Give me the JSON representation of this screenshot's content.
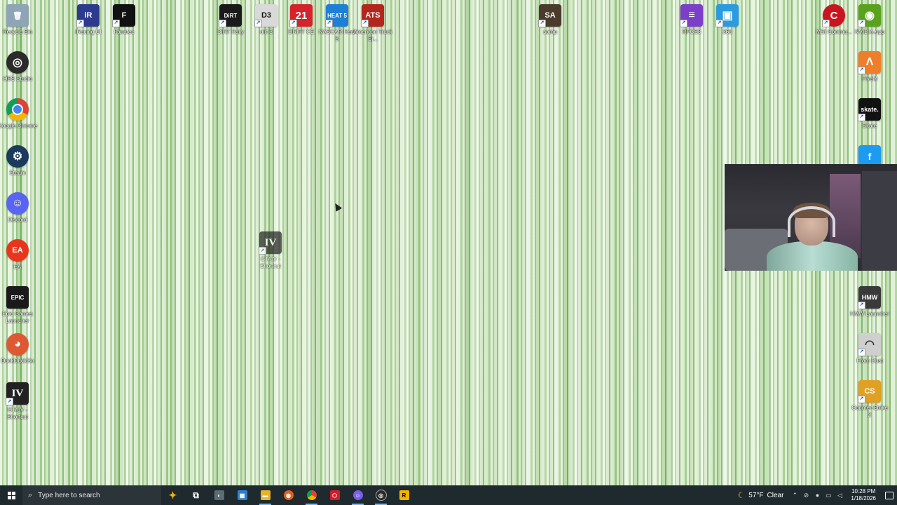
{
  "desktop_icons": [
    {
      "label": "Recycle Bin",
      "glyph": "🗑",
      "color": "#8fa4b5"
    },
    {
      "label": "iRacing UI",
      "glyph": "iR",
      "color": "#2d3b8f"
    },
    {
      "label": "Fanatec",
      "glyph": "F",
      "color": "#111111"
    },
    {
      "label": "DiRT Rally",
      "glyph": "DiRT",
      "color": "#1a1a1a"
    },
    {
      "label": "dirt 3",
      "glyph": "D3",
      "color": "#d9d9d9"
    },
    {
      "label": "DRIFT CE",
      "glyph": "21",
      "color": "#d4232b"
    },
    {
      "label": "NASCAR Heat 5",
      "glyph": "HEAT 5",
      "color": "#1e7fd6"
    },
    {
      "label": "American Truck Si...",
      "glyph": "ATS",
      "color": "#b3261e"
    },
    {
      "label": "samp",
      "glyph": "SA",
      "color": "#4a3b2c"
    },
    {
      "label": "RPCS3",
      "glyph": "≡",
      "color": "#7b3fc8"
    },
    {
      "label": "360",
      "glyph": "▣",
      "color": "#2b9be0"
    },
    {
      "label": "MSI Comma...",
      "glyph": "C",
      "color": "#c9151e"
    },
    {
      "label": "NVIDIA App",
      "glyph": "◉",
      "color": "#5aa21d"
    },
    {
      "label": "OBS Studio",
      "glyph": "◎",
      "color": "#2b2b2b"
    },
    {
      "label": "FiveM",
      "glyph": "Λ",
      "color": "#f07d29"
    },
    {
      "label": "Google Chrome",
      "glyph": "●",
      "color": "#db4437"
    },
    {
      "label": "Skate",
      "glyph": "skate.",
      "color": "#111111"
    },
    {
      "label": "Steam",
      "glyph": "⚙",
      "color": "#1b3a5c"
    },
    {
      "label": "Discord",
      "glyph": "☺",
      "color": "#5865f2"
    },
    {
      "label": "EA",
      "glyph": "EA",
      "color": "#e8361c"
    },
    {
      "label": "Epic Games Launcher",
      "glyph": "EPIC",
      "color": "#1a1a1a"
    },
    {
      "label": "DuckDuckGo",
      "glyph": "◕",
      "color": "#de5833"
    },
    {
      "label": "GTAIV - Shortcut",
      "glyph": "IV",
      "color": "#222222"
    },
    {
      "label": "GTAIV - Shortcut",
      "glyph": "IV",
      "color": "#2a2a2a"
    },
    {
      "label": "HMW Launcher",
      "glyph": "HMW",
      "color": "#3a3a3a"
    },
    {
      "label": "From Dust",
      "glyph": "◠",
      "color": "#cfcfcf"
    },
    {
      "label": "Counter-Strike 2",
      "glyph": "CS",
      "color": "#e0a023"
    },
    {
      "label": "",
      "glyph": "f",
      "color": "#1d9bf0"
    }
  ],
  "taskbar": {
    "search_placeholder": "Type here to search",
    "pinned": [
      {
        "name": "copilot",
        "glyph": "✦",
        "color": "#f5b301"
      },
      {
        "name": "task-view",
        "glyph": "⧉",
        "color": "#1f2a2e"
      },
      {
        "name": "app",
        "glyph": "◐",
        "color": "#5d6b73"
      },
      {
        "name": "store",
        "glyph": "▦",
        "color": "#2f7fd1"
      },
      {
        "name": "file-explorer",
        "glyph": "▬",
        "color": "#e8b32a"
      },
      {
        "name": "app-orange",
        "glyph": "◉",
        "color": "#e85d1c"
      },
      {
        "name": "chrome",
        "glyph": "●",
        "color": "#db4437"
      },
      {
        "name": "app-red",
        "glyph": "⬡",
        "color": "#d01d2a"
      },
      {
        "name": "discord-app",
        "glyph": "☺",
        "color": "#7b5cf0"
      },
      {
        "name": "obs",
        "glyph": "◎",
        "color": "#2b2b2b"
      },
      {
        "name": "rockstar",
        "glyph": "R",
        "color": "#f5b301"
      }
    ],
    "weather": {
      "temp": "57°F",
      "condition": "Clear"
    },
    "clock": {
      "time": "10:28 PM",
      "date": "1/18/2026"
    }
  }
}
